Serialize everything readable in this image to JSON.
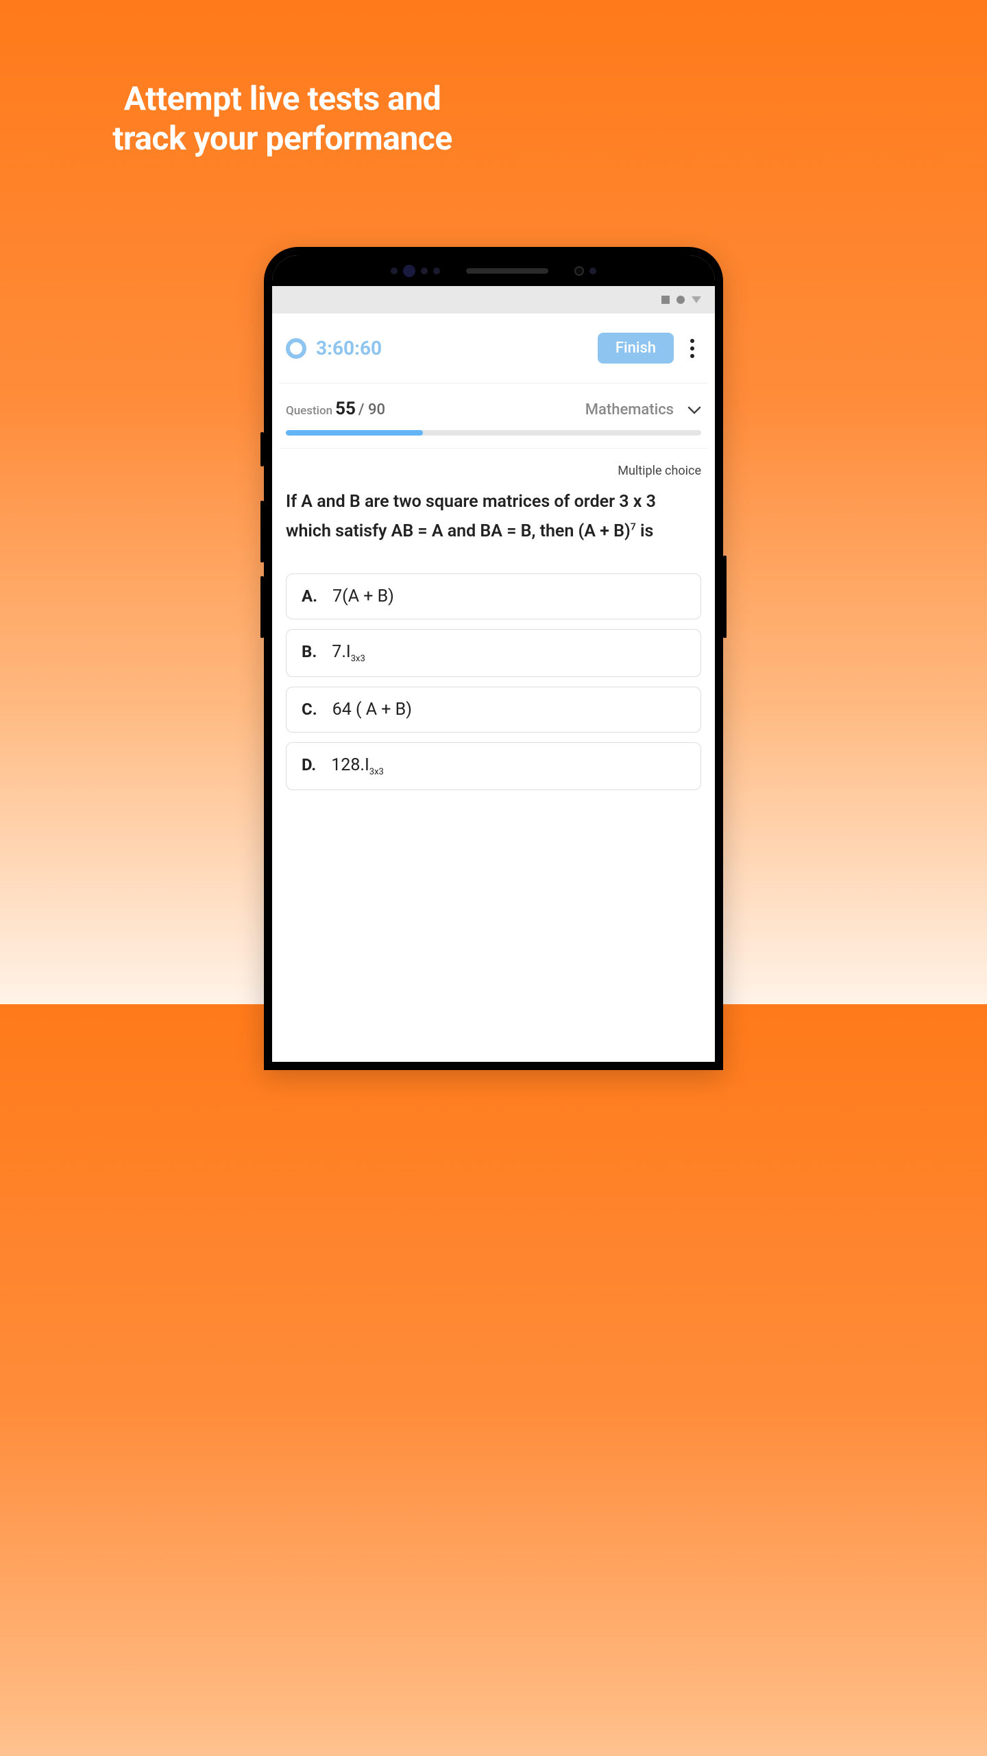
{
  "marketing": {
    "hero_line1": "Attempt live tests and",
    "hero_line2": "track your performance"
  },
  "header": {
    "timer": "3:60:60",
    "finish_label": "Finish"
  },
  "progress": {
    "question_label": "Question",
    "current": "55",
    "separator": "/",
    "total": "90",
    "subject": "Mathematics",
    "percent": 33
  },
  "question": {
    "type_label": "Multiple choice",
    "text_html": "If A and B are two square matrices of order 3 x 3 which satisfy AB = A and BA = B, then (A + B)<sup>7</sup> is",
    "choices": [
      {
        "letter": "A.",
        "text_html": "7(A + B)"
      },
      {
        "letter": "B.",
        "text_html": "7.I<sub>3x3</sub>"
      },
      {
        "letter": "C.",
        "text_html": "64 ( A + B)"
      },
      {
        "letter": "D.",
        "text_html": "128.I<sub>3x3</sub>"
      }
    ]
  }
}
